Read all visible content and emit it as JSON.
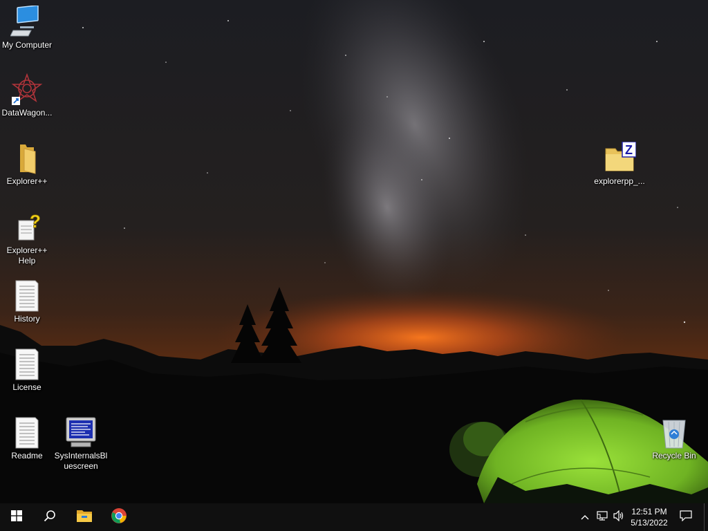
{
  "desktop": {
    "icons": [
      {
        "label": "My Computer",
        "icon": "computer-icon"
      },
      {
        "label": "DataWagon...",
        "icon": "datawagon-shortcut-icon"
      },
      {
        "label": "Explorer++",
        "icon": "folder-icon"
      },
      {
        "label": "Explorer++ Help",
        "icon": "help-file-icon"
      },
      {
        "label": "History",
        "icon": "text-file-icon"
      },
      {
        "label": "License",
        "icon": "text-file-icon"
      },
      {
        "label": "Readme",
        "icon": "text-file-icon"
      },
      {
        "label": "SysInternalsBluescreen",
        "icon": "screensaver-icon"
      },
      {
        "label": "explorerpp_...",
        "icon": "zip-folder-icon"
      },
      {
        "label": "Recycle Bin",
        "icon": "recycle-bin-icon"
      }
    ]
  },
  "taskbar": {
    "start": "windows-start-icon",
    "search": "search-icon",
    "pinned": [
      "file-explorer-icon",
      "chrome-icon"
    ],
    "tray": {
      "chevron": "chevron-up-icon",
      "network": "network-icon",
      "volume": "volume-icon",
      "time": "12:51 PM",
      "date": "5/13/2022",
      "notifications": "action-center-icon"
    }
  },
  "colors": {
    "taskbar": "#101010",
    "tent": "#7cc42a",
    "horizon_glow": "#e8641c"
  }
}
